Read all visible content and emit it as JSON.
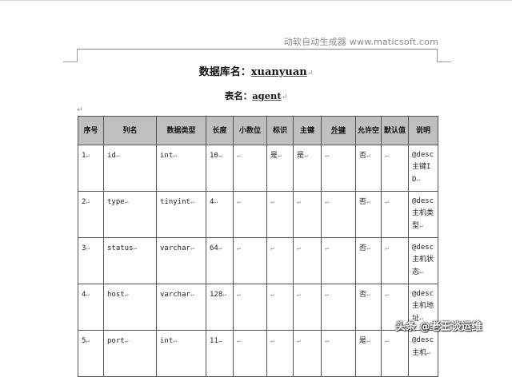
{
  "header": {
    "text": "动软自动生成器 www.maticsoft.com"
  },
  "database": {
    "label": "数据库名：",
    "value": "xuanyuan"
  },
  "table": {
    "label": "表名：",
    "value": "agent"
  },
  "para_mark": "↵",
  "columns": [
    "序号",
    "列名",
    "数据类型",
    "长度",
    "小数位",
    "标识",
    "主键",
    "外键",
    "允许空",
    "默认值",
    "说明"
  ],
  "rows": [
    [
      "1",
      "id",
      "int",
      "10",
      "",
      "是",
      "是",
      "",
      "否",
      "",
      "@desc 主键ID"
    ],
    [
      "2",
      "type",
      "tinyint",
      "4",
      "",
      "",
      "",
      "",
      "否",
      "",
      "@desc 主机类型"
    ],
    [
      "3",
      "status",
      "varchar",
      "64",
      "",
      "",
      "",
      "",
      "否",
      "",
      "@desc 主机状态"
    ],
    [
      "4",
      "host",
      "varchar",
      "128",
      "",
      "",
      "",
      "",
      "否",
      "",
      "@desc 主机地址"
    ],
    [
      "5",
      "port",
      "int",
      "11",
      "",
      "",
      "",
      "",
      "是",
      "",
      "@desc 主机"
    ]
  ],
  "watermark": "头条 @老王谈运维"
}
